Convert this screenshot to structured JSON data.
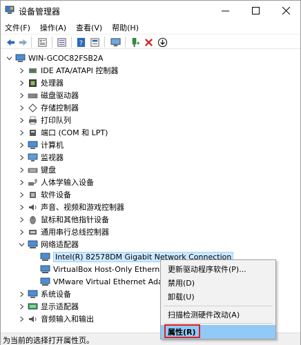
{
  "window": {
    "title": "设备管理器",
    "icon": "device-manager-icon",
    "controls": [
      "minimize-icon",
      "maximize-icon",
      "close-icon"
    ]
  },
  "menubar": {
    "items": [
      {
        "label": "文件(F)"
      },
      {
        "label": "操作(A)"
      },
      {
        "label": "查看(V)"
      },
      {
        "label": "帮助(H)"
      }
    ]
  },
  "toolbar": {
    "buttons": [
      "back-icon",
      "forward-icon",
      "properties-icon",
      "show-hidden-icon",
      "help-icon",
      "refresh-view-icon",
      "scan-hardware-icon",
      "add-driver-icon",
      "uninstall-icon",
      "update-driver-icon"
    ]
  },
  "tree": {
    "root": {
      "label": "WIN-GCOC82FSB2A",
      "icon": "computer-icon"
    },
    "categories": [
      {
        "label": "IDE ATA/ATAPI 控制器",
        "icon": "ide-controller-icon"
      },
      {
        "label": "处理器",
        "icon": "processor-icon"
      },
      {
        "label": "磁盘驱动器",
        "icon": "disk-drive-icon"
      },
      {
        "label": "存储控制器",
        "icon": "storage-controller-icon"
      },
      {
        "label": "打印队列",
        "icon": "printer-icon"
      },
      {
        "label": "端口 (COM 和 LPT)",
        "icon": "port-icon"
      },
      {
        "label": "计算机",
        "icon": "computer-icon"
      },
      {
        "label": "监视器",
        "icon": "monitor-icon"
      },
      {
        "label": "键盘",
        "icon": "keyboard-icon"
      },
      {
        "label": "人体学输入设备",
        "icon": "hid-icon"
      },
      {
        "label": "软件设备",
        "icon": "software-device-icon"
      },
      {
        "label": "声音、视频和游戏控制器",
        "icon": "sound-icon"
      },
      {
        "label": "鼠标和其他指针设备",
        "icon": "mouse-icon"
      },
      {
        "label": "通用串行总线控制器",
        "icon": "usb-icon"
      },
      {
        "label": "网络适配器",
        "icon": "network-adapter-icon"
      }
    ],
    "network_children": [
      {
        "label": "Intel(R) 82578DM Gigabit Network Connection",
        "selected": true
      },
      {
        "label": "VirtualBox Host-Only Ethernet Adapter"
      },
      {
        "label": "VMware Virtual Ethernet Adapter"
      }
    ],
    "after_categories": [
      {
        "label": "系统设备",
        "icon": "system-device-icon"
      },
      {
        "label": "显示适配器",
        "icon": "display-adapter-icon"
      },
      {
        "label": "音频输入和输出",
        "icon": "audio-io-icon"
      }
    ]
  },
  "context_menu": {
    "items": [
      {
        "label": "更新驱动程序软件(P)..."
      },
      {
        "label": "禁用(D)"
      },
      {
        "label": "卸载(U)"
      },
      {
        "label": "扫描检测硬件改动(A)"
      },
      {
        "label": "属性(R)",
        "highlighted": true
      }
    ]
  },
  "statusbar": {
    "text": "为当前的选择打开属性页。"
  },
  "colors": {
    "selection": "#cce8ff",
    "menu_highlight": "#91c9f7",
    "annotation_box": "#e02020"
  }
}
